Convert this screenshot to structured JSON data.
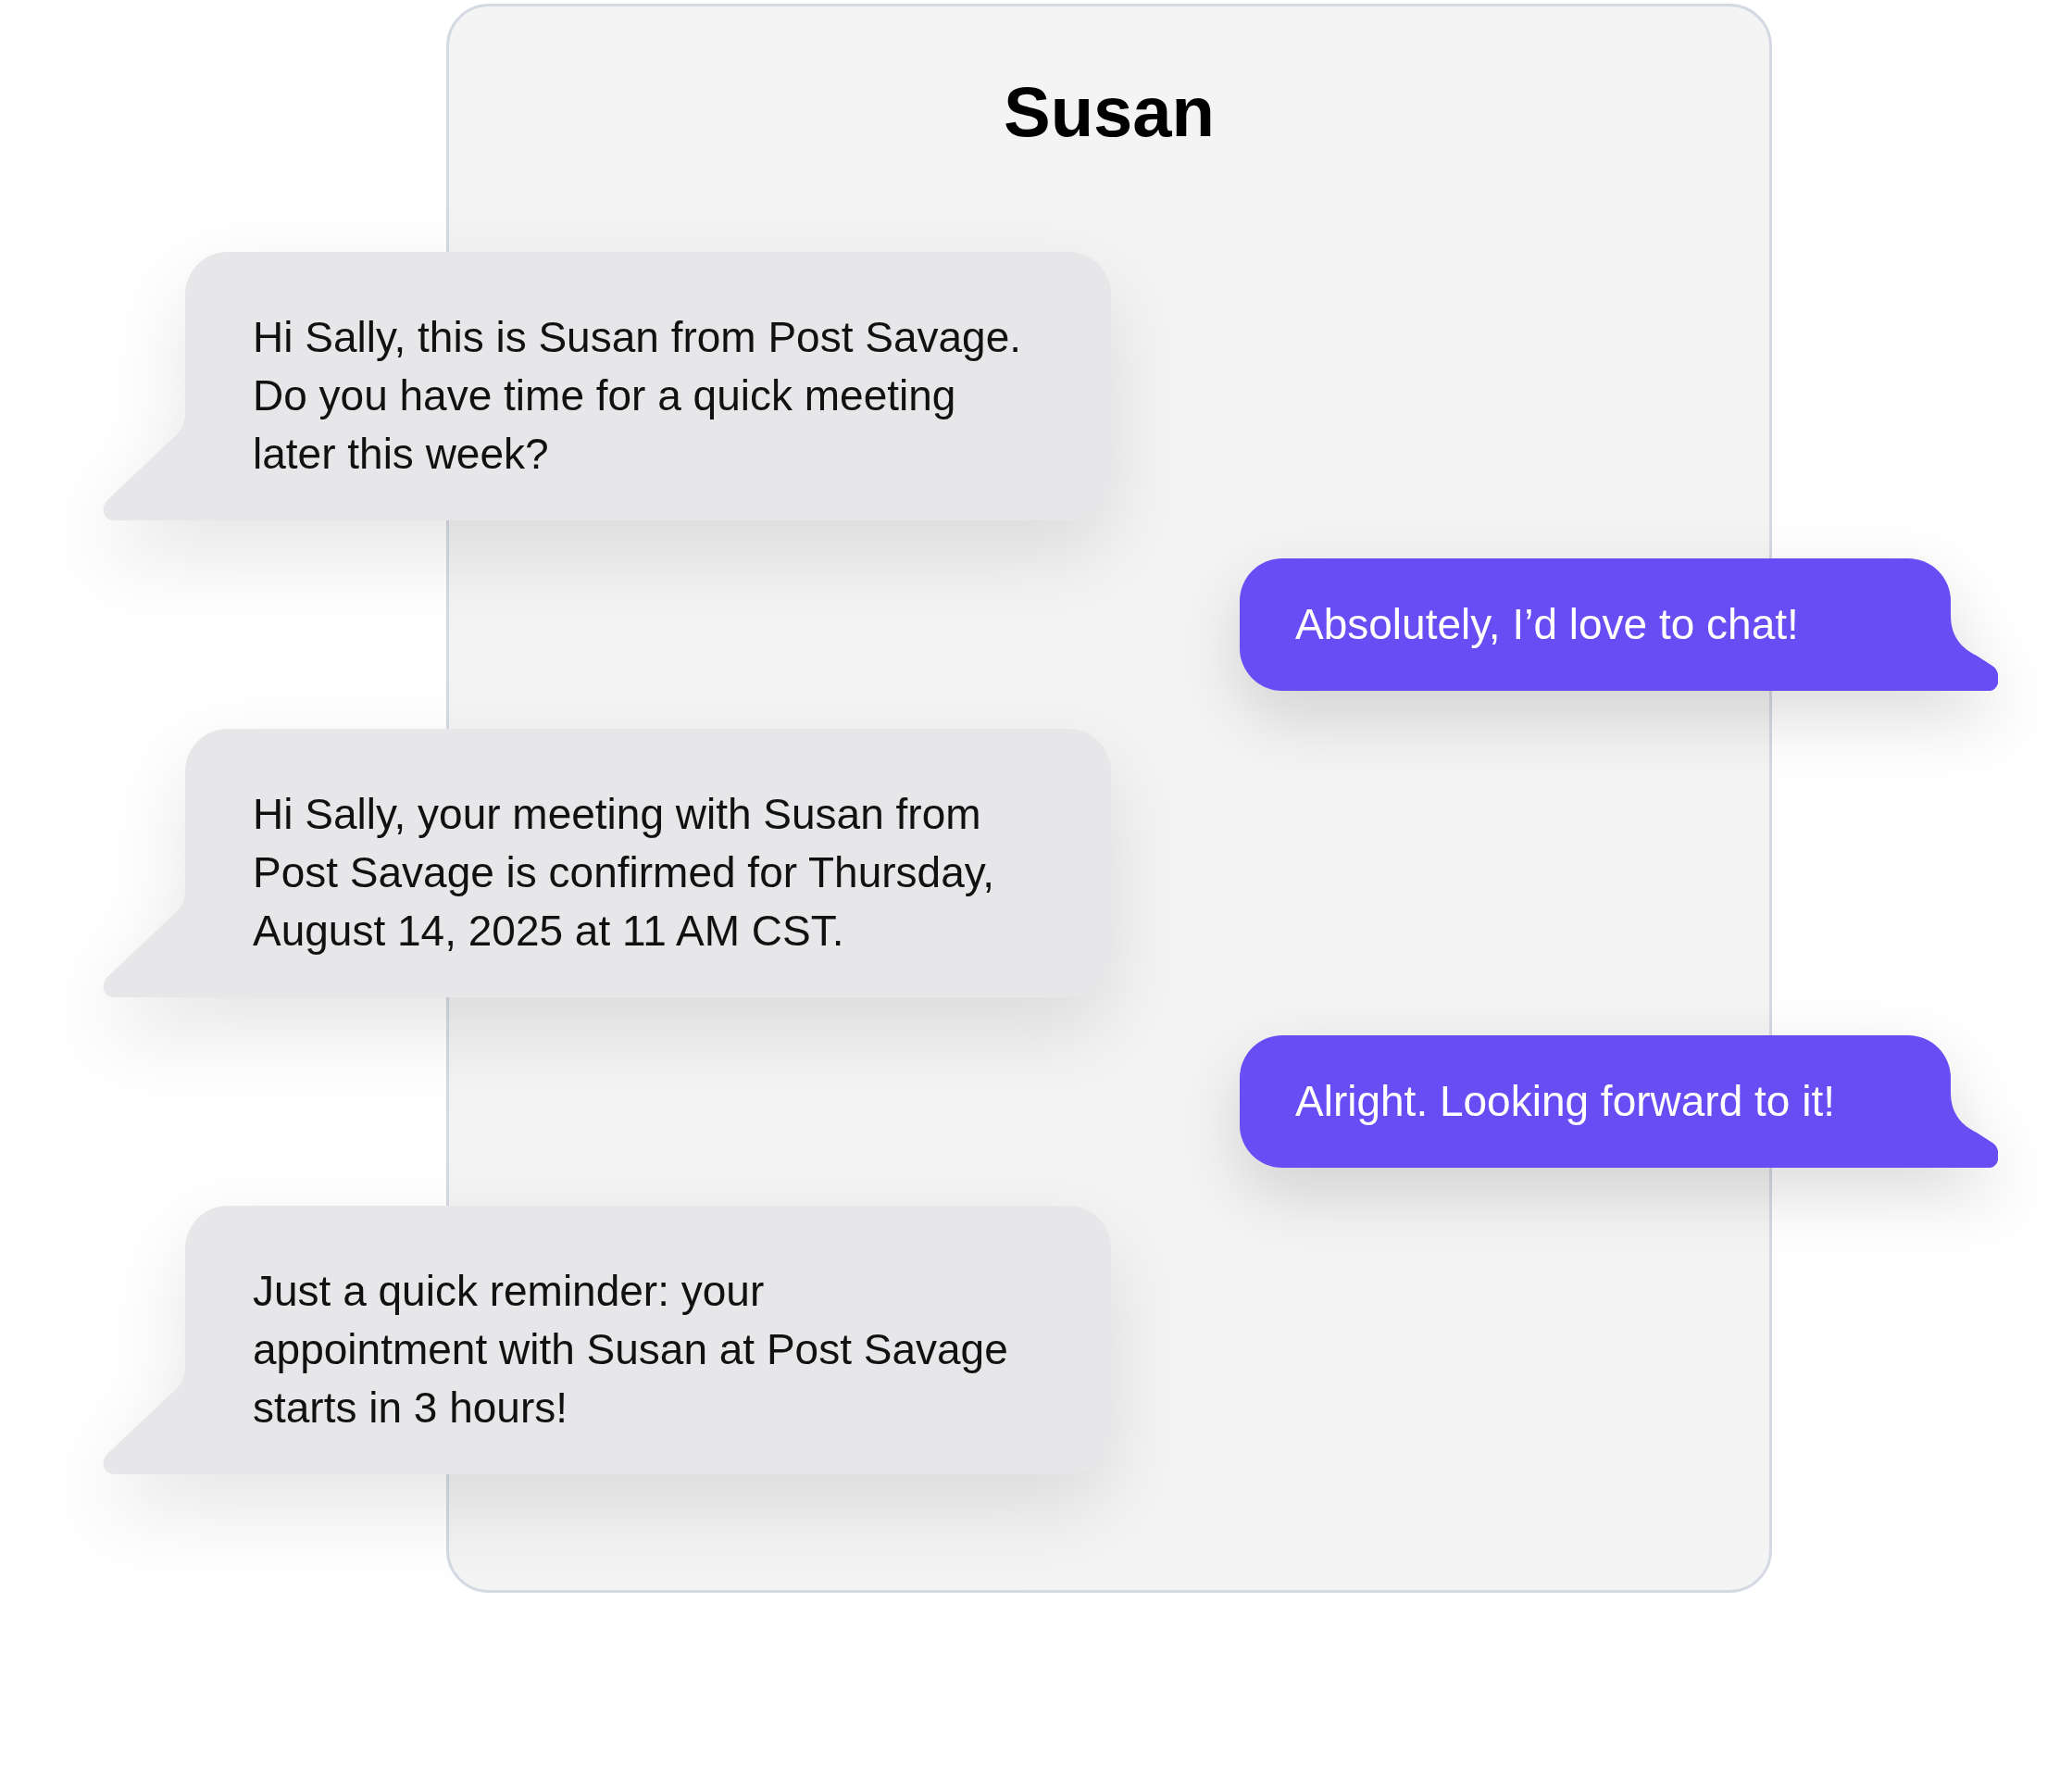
{
  "conversation": {
    "title": "Susan"
  },
  "messages": [
    {
      "kind": "incoming",
      "text": "Hi Sally, this is Susan from Post Savage.\nDo you have time for a quick meeting\nlater this week?"
    },
    {
      "kind": "outgoing",
      "text": "Absolutely, I’d love to chat!"
    },
    {
      "kind": "incoming",
      "text": "Hi Sally, your meeting with Susan from\nPost Savage is confirmed for Thursday,\nAugust 14, 2025 at 11 AM CST."
    },
    {
      "kind": "outgoing",
      "text": "Alright. Looking forward to it!"
    },
    {
      "kind": "incoming",
      "text": "Just a quick reminder: your\nappointment with Susan at Post Savage\nstarts in 3 hours!"
    }
  ]
}
